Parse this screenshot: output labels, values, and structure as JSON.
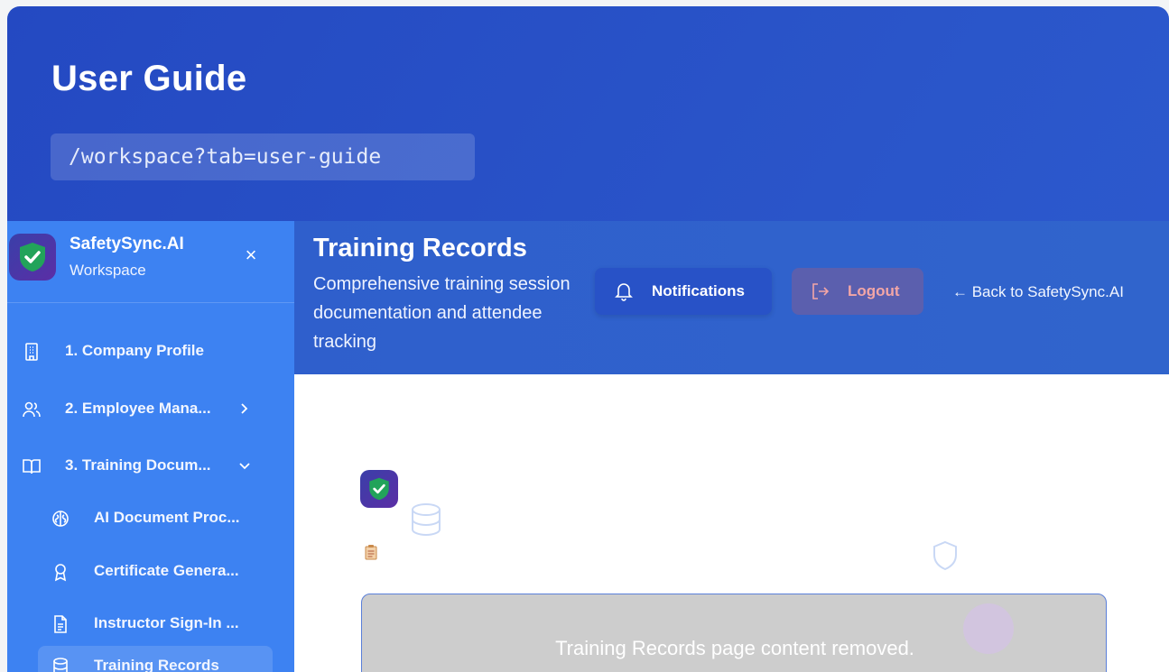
{
  "guide": {
    "title": "User Guide",
    "url": "/workspace?tab=user-guide"
  },
  "sidebar": {
    "brand_name": "SafetySync.AI",
    "brand_sub": "Workspace",
    "close_glyph": "×",
    "items": [
      {
        "label": "1. Company Profile",
        "icon": "building-icon"
      },
      {
        "label": "2. Employee Mana...",
        "icon": "users-icon",
        "chevron": "right"
      },
      {
        "label": "3. Training Docum...",
        "icon": "book-icon",
        "chevron": "down"
      },
      {
        "label": "AI Document Proc...",
        "icon": "brain-icon"
      },
      {
        "label": "Certificate Genera...",
        "icon": "award-icon"
      },
      {
        "label": "Instructor Sign-In ...",
        "icon": "file-text-icon"
      },
      {
        "label": "Training Records",
        "icon": "database-icon",
        "active": true
      }
    ]
  },
  "main": {
    "title": "Training Records",
    "subtitle": "Comprehensive training session documentation and attendee tracking",
    "notifications_label": "Notifications",
    "logout_label": "Logout",
    "back_label": "← Back to SafetySync.AI",
    "placeholder_text": "Training Records page content removed."
  },
  "colors": {
    "header_bg": "#2a55c9",
    "sidebar_bg": "#3d82f2",
    "notif_bg": "#2852c7",
    "logout_bg": "#5b5fae",
    "logout_text": "#f3a6a6"
  }
}
